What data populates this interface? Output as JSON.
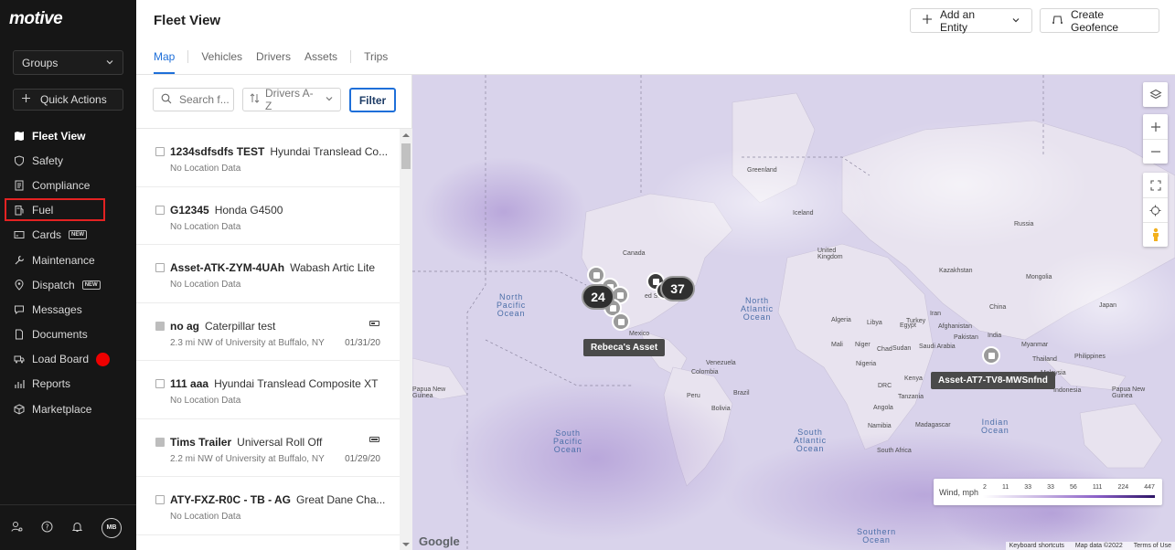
{
  "app": {
    "logo": "motive"
  },
  "sidebar": {
    "groups_label": "Groups",
    "quick_actions_label": "Quick Actions",
    "items": [
      {
        "label": "Fleet View",
        "icon": "map-icon",
        "active": true
      },
      {
        "label": "Safety",
        "icon": "shield-icon"
      },
      {
        "label": "Compliance",
        "icon": "document-list-icon"
      },
      {
        "label": "Fuel",
        "icon": "fuel-pump-icon"
      },
      {
        "label": "Cards",
        "icon": "card-icon",
        "badge": "NEW"
      },
      {
        "label": "Maintenance",
        "icon": "wrench-icon"
      },
      {
        "label": "Dispatch",
        "icon": "location-pin-icon",
        "badge": "NEW"
      },
      {
        "label": "Messages",
        "icon": "chat-icon"
      },
      {
        "label": "Documents",
        "icon": "file-icon"
      },
      {
        "label": "Load Board",
        "icon": "truck-icon",
        "dot_color": "#e00000"
      },
      {
        "label": "Reports",
        "icon": "chart-icon"
      },
      {
        "label": "Marketplace",
        "icon": "cube-icon"
      }
    ],
    "avatar_initials": "MB"
  },
  "header": {
    "title": "Fleet View",
    "add_entity_label": "Add an Entity",
    "create_geofence_label": "Create Geofence",
    "tabs": [
      {
        "label": "Map",
        "active": true
      },
      {
        "label": "Vehicles"
      },
      {
        "label": "Drivers"
      },
      {
        "label": "Assets"
      },
      {
        "label": "Trips"
      }
    ]
  },
  "list_panel": {
    "search_placeholder": "Search f...",
    "sort_label": "Drivers A-Z",
    "filter_label": "Filter",
    "rows": [
      {
        "name": "1234sdfsdfs TEST",
        "model": "Hyundai Translead Co...",
        "location": "No Location Data"
      },
      {
        "name": "G12345",
        "model": "Honda G4500",
        "location": "No Location Data"
      },
      {
        "name": "Asset-ATK-ZYM-4UAh",
        "model": "Wabash Artic Lite",
        "location": "No Location Data"
      },
      {
        "name": "no ag",
        "model": "Caterpillar test",
        "location": "2.3 mi NW of University at Buffalo, NY",
        "date": "01/31/20"
      },
      {
        "name": "111 aaa",
        "model": "Hyundai Translead Composite XT",
        "location": "No Location Data"
      },
      {
        "name": "Tims Trailer",
        "model": "Universal Roll Off",
        "location": "2.2 mi NW of University at Buffalo, NY",
        "date": "01/29/20"
      },
      {
        "name": "ATY-FXZ-R0C - TB - AG",
        "model": "Great Dane Cha...",
        "location": "No Location Data"
      }
    ]
  },
  "map": {
    "oceans": {
      "north_pacific": "North\nPacific\nOcean",
      "north_atlantic": "North\nAtlantic\nOcean",
      "south_pacific": "South\nPacific\nOcean",
      "south_atlantic": "South\nAtlantic\nOcean",
      "indian": "Indian\nOcean",
      "southern": "Southern\nOcean"
    },
    "places": {
      "greenland": "Greenland",
      "iceland": "Iceland",
      "russia": "Russia",
      "canada": "Canada",
      "united_kingdom": "United\nKingdom",
      "mongolia": "Mongolia",
      "kazakhstan": "Kazakhstan",
      "china": "China",
      "egypt": "Egypt",
      "libya": "Libya",
      "algeria": "Algeria",
      "saudi_arabia": "Saudi Arabia",
      "mali": "Mali",
      "niger": "Niger",
      "chad": "Chad",
      "sudan": "Sudan",
      "nigeria": "Nigeria",
      "kenya": "Kenya",
      "drc": "DRC",
      "tanzania": "Tanzania",
      "angola": "Angola",
      "namibia": "Namibia",
      "south_africa": "South Africa",
      "madagascar": "Madagascar",
      "india": "India",
      "iran": "Iran",
      "afghanistan": "Afghanistan",
      "pakistan": "Pakistan",
      "turkey": "Turkey",
      "colombia": "Colombia",
      "venezuela": "Venezuela",
      "peru": "Peru",
      "brazil": "Brazil",
      "bolivia": "Bolivia",
      "mexico": "Mexico",
      "united_states": "ed States",
      "myanmar": "Myanmar",
      "thailand": "Thailand",
      "philippines": "Philippines",
      "indonesia": "Indonesia",
      "papua_new_guinea": "Papua New\nGuinea",
      "papua_new_guinea_left": "Papua New\nGuinea",
      "japan": "Japan",
      "malaysia": "Malaysia"
    },
    "clusters": [
      {
        "label": "24"
      },
      {
        "label": "37"
      }
    ],
    "tooltips": {
      "rebeca": "Rebeca's Asset",
      "asset_at7": "Asset-AT7-TV8-MWSnfnd"
    },
    "legend": {
      "label": "Wind, mph",
      "ticks": [
        "2",
        "11",
        "33",
        "33",
        "56",
        "111",
        "224",
        "447"
      ]
    },
    "google_label": "Google",
    "attribution": {
      "shortcuts": "Keyboard shortcuts",
      "map_data": "Map data ©2022",
      "terms": "Terms of Use"
    }
  }
}
